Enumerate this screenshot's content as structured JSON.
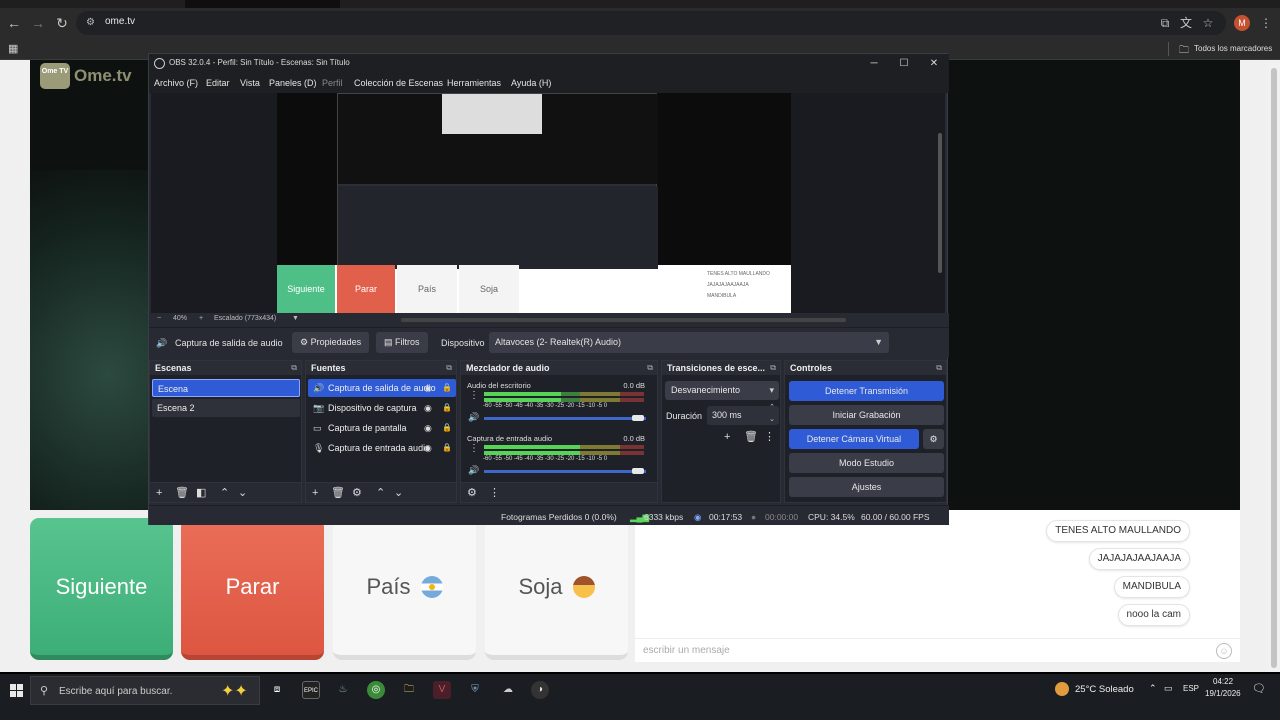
{
  "browser": {
    "url": "ome.tv",
    "bookmarks_folder": "Todos los marcadores",
    "profile_initial": "M"
  },
  "page": {
    "logo_badge": "Ome TV",
    "logo_text": "Ome.tv",
    "buttons": {
      "next": "Siguiente",
      "stop": "Parar",
      "country": "País",
      "gender": "Soja"
    },
    "chat_messages": [
      "TENES ALTO MAULLANDO",
      "JAJAJAJAAJAAJA",
      "MANDIBULA",
      "nooo la cam"
    ],
    "chat_placeholder": "escribir un mensaje"
  },
  "obs": {
    "title": "OBS 32.0.4 - Perfil: Sin Título - Escenas: Sin Título",
    "menu": [
      "Archivo (F)",
      "Editar",
      "Vista",
      "Paneles (D)",
      "Perfil",
      "Colección de Escenas",
      "Herramientas",
      "Ayuda (H)"
    ],
    "preview": {
      "zoom": "40%",
      "scale": "Escalado (773x434)",
      "mini_buttons": {
        "next": "Siguiente",
        "stop": "Parar",
        "country": "País",
        "gender": "Soja"
      },
      "mini_chat": [
        "TENES ALTO MAULLANDO",
        "JAJAJAJAAJAAJA",
        "MANDIBULA"
      ]
    },
    "source_bar": {
      "selected_source": "Captura de salida de audio",
      "properties": "Propiedades",
      "filters": "Filtros",
      "device_label": "Dispositivo",
      "device_value": "Altavoces (2- Realtek(R) Audio)"
    },
    "scenes": {
      "header": "Escenas",
      "items": [
        "Escena",
        "Escena 2"
      ]
    },
    "sources": {
      "header": "Fuentes",
      "items": [
        "Captura de salida de audio",
        "Dispositivo de captura",
        "Captura de pantalla",
        "Captura de entrada audio"
      ]
    },
    "mixer": {
      "header": "Mezclador de audio",
      "channels": [
        {
          "name": "Audio del escritorio",
          "db": "0.0 dB",
          "level": 0.48
        },
        {
          "name": "Captura de entrada audio",
          "db": "0.0 dB",
          "level": 0.6
        }
      ],
      "ticks": "-60 -55 -50 -45 -40 -35 -30 -25 -20 -15 -10 -5 0"
    },
    "transitions": {
      "header": "Transiciones de esce...",
      "selected": "Desvanecimiento",
      "duration_label": "Duración",
      "duration_value": "300 ms"
    },
    "controls": {
      "header": "Controles",
      "stop_stream": "Detener Transmisión",
      "start_recording": "Iniciar Grabación",
      "stop_virtual_cam": "Detener Cámara Virtual",
      "studio_mode": "Modo Estudio",
      "settings": "Ajustes"
    },
    "status": {
      "dropped_frames": "Fotogramas Perdidos 0 (0.0%)",
      "bitrate": "6333 kbps",
      "stream_time": "00:17:53",
      "record_time": "00:00:00",
      "cpu": "CPU: 34.5%",
      "fps": "60.00 / 60.00 FPS"
    }
  },
  "taskbar": {
    "search_placeholder": "Escribe aquí para buscar.",
    "weather": "25°C  Soleado",
    "language": "ESP",
    "time": "04:22",
    "date": "19/1/2026"
  },
  "colors": {
    "next_green": "#3dae77",
    "stop_red": "#dd5641",
    "obs_accent": "#2f5bd6"
  }
}
